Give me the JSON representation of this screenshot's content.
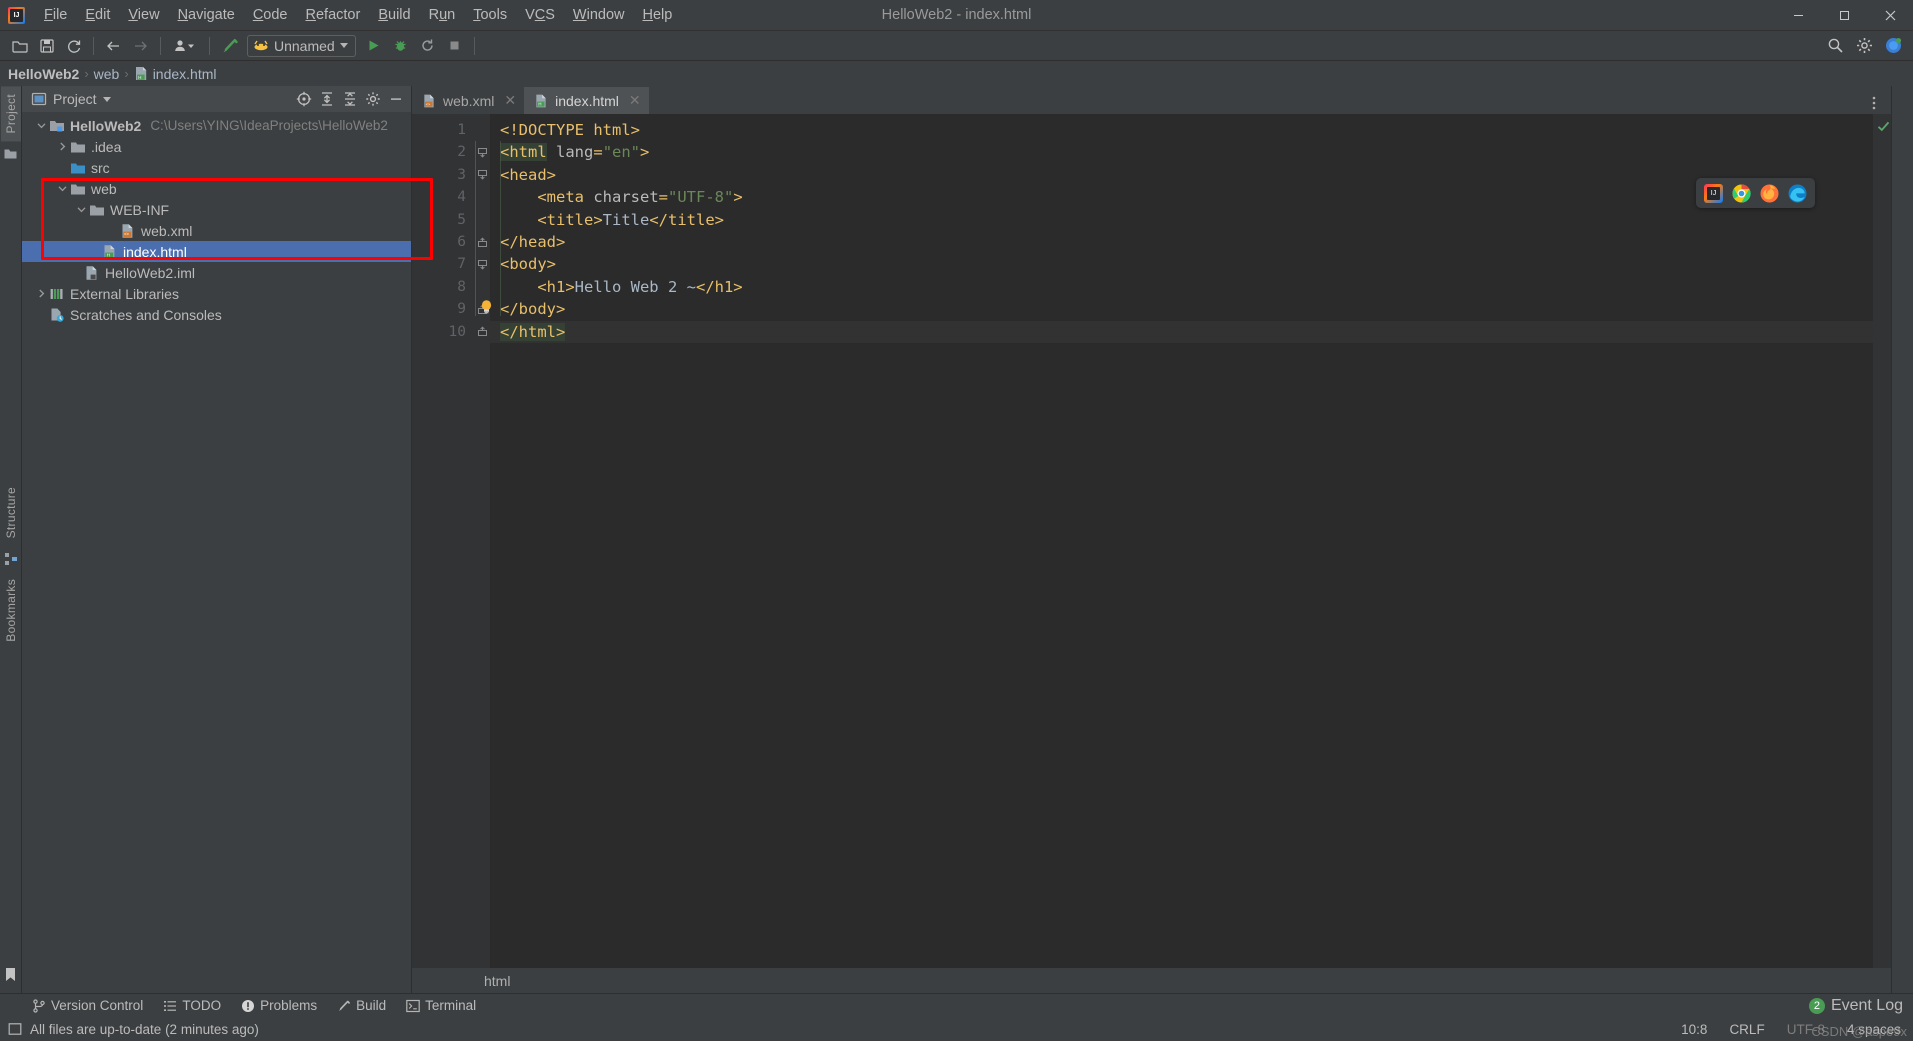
{
  "window": {
    "title": "HelloWeb2 - index.html",
    "app_icon": "intellij-logo-icon",
    "minimize": "─",
    "maximize": "❐",
    "close": "✕"
  },
  "menu": [
    {
      "label": "File"
    },
    {
      "label": "Edit"
    },
    {
      "label": "View"
    },
    {
      "label": "Navigate"
    },
    {
      "label": "Code"
    },
    {
      "label": "Refactor"
    },
    {
      "label": "Build"
    },
    {
      "label": "Run"
    },
    {
      "label": "Tools"
    },
    {
      "label": "VCS"
    },
    {
      "label": "Window"
    },
    {
      "label": "Help"
    }
  ],
  "toolbar": {
    "open_icon": "open-folder-icon",
    "save_icon": "save-icon",
    "sync_icon": "refresh-icon",
    "back_icon": "arrow-left-icon",
    "forward_icon": "arrow-right-icon",
    "profile_icon": "user-dropdown-icon",
    "build_icon": "hammer-icon",
    "run_config_label": "Unnamed",
    "run_config_icon": "tomcat-icon",
    "run_icon": "run-play-icon",
    "debug_icon": "debug-bug-icon",
    "rerun_icon": "rerun-icon",
    "stop_icon": "stop-square-icon",
    "search_icon": "search-everywhere-icon",
    "settings_icon": "gear-icon",
    "updates_icon": "ide-update-icon"
  },
  "breadcrumb": {
    "items": [
      {
        "label": "HelloWeb2",
        "icon": "project-icon"
      },
      {
        "label": "web",
        "icon": "folder-icon"
      },
      {
        "label": "index.html",
        "icon": "html-file-icon"
      }
    ],
    "separator": "›"
  },
  "left_stripe": {
    "project_label": "Project",
    "structure_label": "Structure",
    "bookmarks_label": "Bookmarks",
    "commit_icon": "commit-folder-icon",
    "structure_icon": "structure-icon",
    "bookmarks_icon": "bookmark-icon"
  },
  "project_panel": {
    "title": "Project",
    "view_icon": "project-view-icon",
    "dropdown_icon": "chevron-down-icon",
    "tools": [
      {
        "name": "select-opened-file-icon",
        "label": ""
      },
      {
        "name": "expand-all-icon",
        "label": ""
      },
      {
        "name": "collapse-all-icon",
        "label": ""
      },
      {
        "name": "gear-icon",
        "label": ""
      },
      {
        "name": "hide-panel-icon",
        "label": ""
      }
    ],
    "tree": [
      {
        "label": "HelloWeb2",
        "path": "C:\\Users\\YING\\IdeaProjects\\HelloWeb2",
        "icon": "project-root-icon",
        "indent": 0,
        "arrow": "down",
        "bold": true,
        "selected": false
      },
      {
        "label": ".idea",
        "path": "",
        "icon": "folder-icon",
        "indent": 1,
        "arrow": "right",
        "bold": false,
        "selected": false
      },
      {
        "label": "src",
        "path": "",
        "icon": "source-folder-icon",
        "indent": 1,
        "arrow": "none",
        "bold": false,
        "selected": false
      },
      {
        "label": "web",
        "path": "",
        "icon": "folder-icon",
        "indent": 1,
        "arrow": "down",
        "bold": false,
        "selected": false
      },
      {
        "label": "WEB-INF",
        "path": "",
        "icon": "folder-icon",
        "indent": 2,
        "arrow": "down",
        "bold": false,
        "selected": false
      },
      {
        "label": "web.xml",
        "path": "",
        "icon": "xml-file-icon",
        "indent": 3,
        "arrow": "none",
        "bold": false,
        "selected": false
      },
      {
        "label": "index.html",
        "path": "",
        "icon": "html-file-icon",
        "indent": 2,
        "arrow": "none",
        "bold": false,
        "selected": true
      },
      {
        "label": "HelloWeb2.iml",
        "path": "",
        "icon": "iml-file-icon",
        "indent": 2,
        "arrow": "none",
        "bold": false,
        "selected": false
      },
      {
        "label": "External Libraries",
        "path": "",
        "icon": "libraries-icon",
        "indent": 0,
        "arrow": "right",
        "bold": false,
        "selected": false
      },
      {
        "label": "Scratches and Consoles",
        "path": "",
        "icon": "scratches-icon",
        "indent": 0,
        "arrow": "none",
        "bold": false,
        "selected": false
      }
    ]
  },
  "editor": {
    "tabs": [
      {
        "label": "web.xml",
        "icon": "xml-file-icon",
        "active": false,
        "close": "✕"
      },
      {
        "label": "index.html",
        "icon": "html-file-icon",
        "active": true,
        "close": "✕"
      }
    ],
    "more_icon": "more-vertical-icon",
    "inspection_status_icon": "inspection-ok-icon",
    "bottom_breadcrumb": "html",
    "lines": [
      {
        "n": 1,
        "fold": "none",
        "current": false,
        "tokens": [
          {
            "t": "<!DOCTYPE html>",
            "c": "dt"
          }
        ]
      },
      {
        "n": 2,
        "fold": "open",
        "current": false,
        "tokens": [
          {
            "t": "<html",
            "c": "tg hl"
          },
          {
            "t": " ",
            "c": "tx"
          },
          {
            "t": "lang",
            "c": "at"
          },
          {
            "t": "=",
            "c": "tg"
          },
          {
            "t": "\"en\"",
            "c": "av"
          },
          {
            "t": ">",
            "c": "tg"
          }
        ]
      },
      {
        "n": 3,
        "fold": "open",
        "current": false,
        "tokens": [
          {
            "t": "<head>",
            "c": "tg"
          }
        ]
      },
      {
        "n": 4,
        "fold": "none",
        "current": false,
        "tokens": [
          {
            "t": "    <meta",
            "c": "tg"
          },
          {
            "t": " ",
            "c": "tx"
          },
          {
            "t": "charset",
            "c": "at"
          },
          {
            "t": "=",
            "c": "tg"
          },
          {
            "t": "\"UTF-8\"",
            "c": "av"
          },
          {
            "t": ">",
            "c": "tg"
          }
        ]
      },
      {
        "n": 5,
        "fold": "none",
        "current": false,
        "tokens": [
          {
            "t": "    <title>",
            "c": "tg"
          },
          {
            "t": "Title",
            "c": "tx"
          },
          {
            "t": "</title>",
            "c": "tg"
          }
        ]
      },
      {
        "n": 6,
        "fold": "close",
        "current": false,
        "tokens": [
          {
            "t": "</head>",
            "c": "tg"
          }
        ]
      },
      {
        "n": 7,
        "fold": "open",
        "current": false,
        "tokens": [
          {
            "t": "<body>",
            "c": "tg"
          }
        ]
      },
      {
        "n": 8,
        "fold": "none",
        "current": false,
        "tokens": [
          {
            "t": "    <h1>",
            "c": "tg"
          },
          {
            "t": "Hello Web 2 ~",
            "c": "tx"
          },
          {
            "t": "</h1>",
            "c": "tg"
          }
        ]
      },
      {
        "n": 9,
        "fold": "close",
        "current": false,
        "tokens": [
          {
            "t": "</body>",
            "c": "tg"
          }
        ]
      },
      {
        "n": 10,
        "fold": "close",
        "current": true,
        "tokens": [
          {
            "t": "</html>",
            "c": "tg hl"
          }
        ]
      }
    ],
    "intention_icon": "lightbulb-icon"
  },
  "browser_popup": {
    "icons": [
      {
        "name": "intellij-browser-icon"
      },
      {
        "name": "chrome-browser-icon"
      },
      {
        "name": "firefox-browser-icon"
      },
      {
        "name": "edge-browser-icon"
      }
    ]
  },
  "toolwindow_bar": {
    "items": [
      {
        "label": "Version Control",
        "icon": "branch-icon"
      },
      {
        "label": "TODO",
        "icon": "todo-list-icon"
      },
      {
        "label": "Problems",
        "icon": "problems-icon"
      },
      {
        "label": "Build",
        "icon": "hammer-icon"
      },
      {
        "label": "Terminal",
        "icon": "terminal-icon"
      }
    ],
    "event_log_label": "Event Log",
    "event_log_count": "2"
  },
  "statusbar": {
    "message_icon": "status-message-icon",
    "message": "All files are up-to-date (2 minutes ago)",
    "caret_position": "10:8",
    "line_separator": "CRLF",
    "encoding": "UTF-8",
    "indent": "4 spaces",
    "watermark": "CSDN @aspe9x"
  },
  "colors": {
    "accent_selection": "#4b6eaf",
    "annotation_red": "#ff0000",
    "tag_orange": "#e8bf6a",
    "string_green": "#6a8759",
    "text_blue_grey": "#a9b7c6",
    "panel_bg": "#3c3f41",
    "editor_bg": "#2b2b2b",
    "gutter_bg": "#313335",
    "badge_green": "#499c54"
  }
}
